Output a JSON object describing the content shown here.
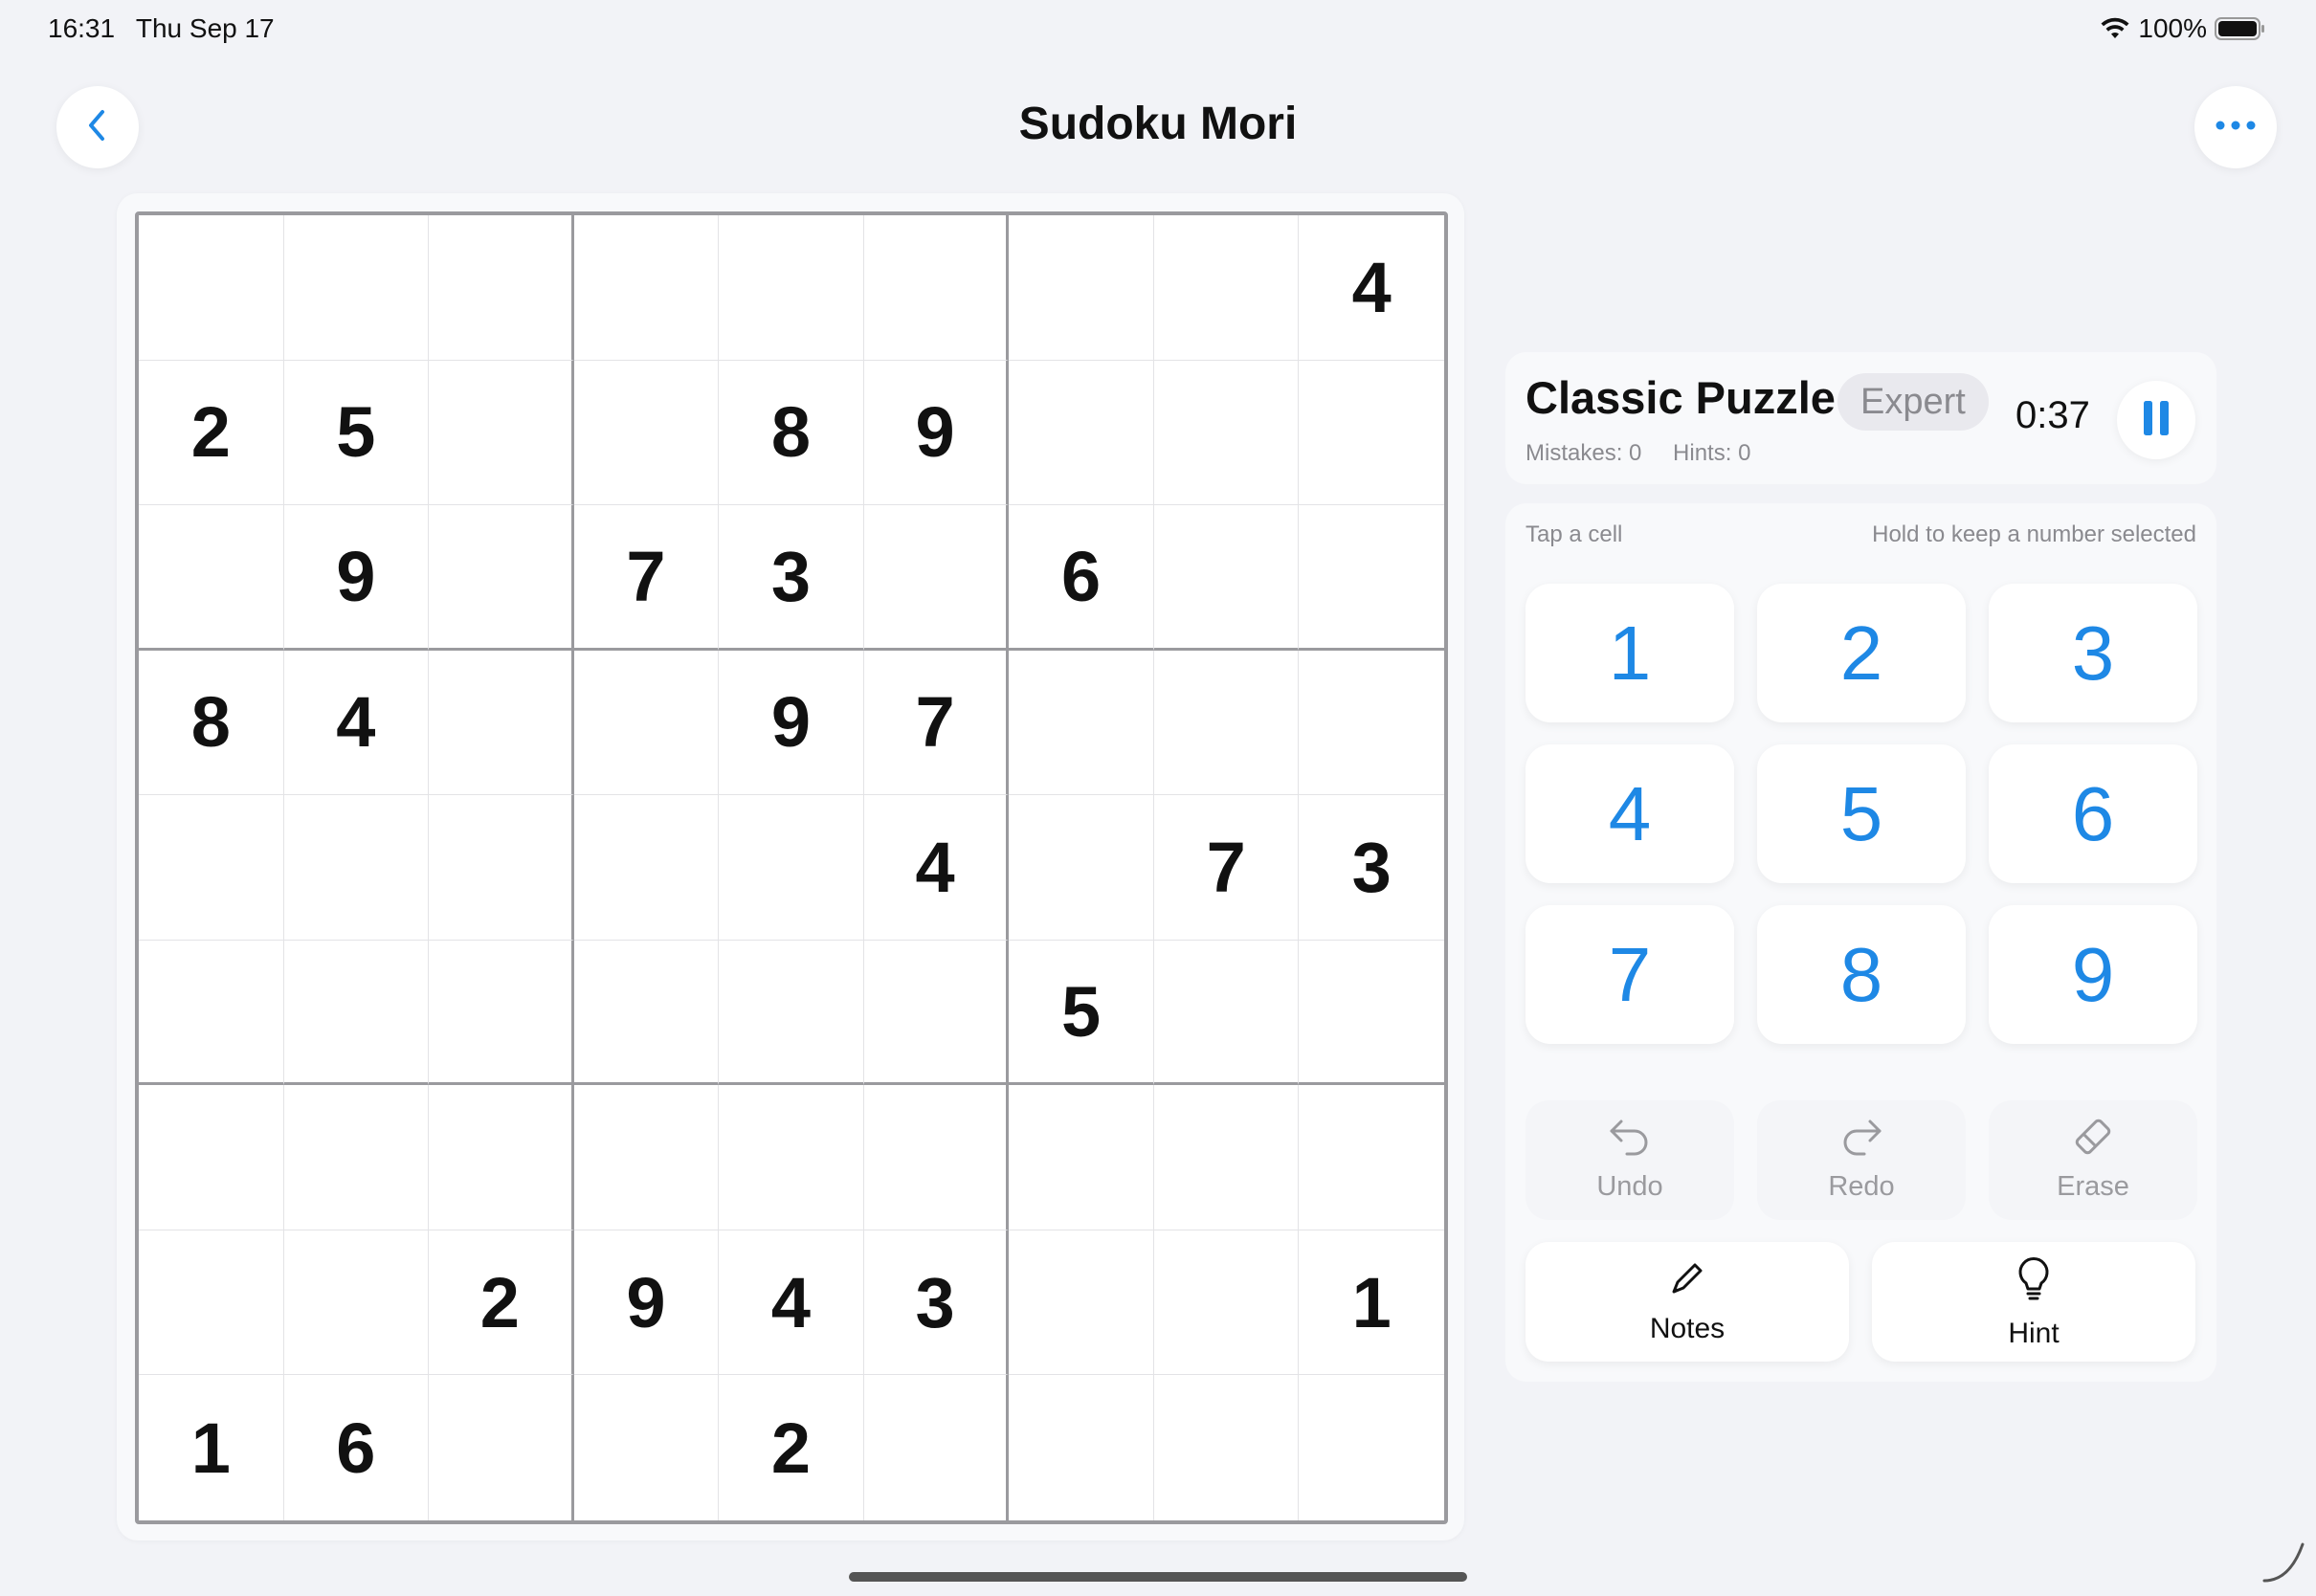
{
  "status": {
    "time": "16:31",
    "date": "Thu Sep 17",
    "battery": "100%"
  },
  "header": {
    "title": "Sudoku Mori",
    "back_icon": "chevron-left-icon",
    "more_icon": "ellipsis-icon"
  },
  "board": {
    "rows": [
      [
        "",
        "",
        "",
        "",
        "",
        "",
        "",
        "",
        "4"
      ],
      [
        "2",
        "5",
        "",
        "",
        "8",
        "9",
        "",
        "",
        ""
      ],
      [
        "",
        "9",
        "",
        "7",
        "3",
        "",
        "6",
        "",
        ""
      ],
      [
        "8",
        "4",
        "",
        "",
        "9",
        "7",
        "",
        "",
        ""
      ],
      [
        "",
        "",
        "",
        "",
        "",
        "4",
        "",
        "7",
        "3"
      ],
      [
        "",
        "",
        "",
        "",
        "",
        "",
        "5",
        "",
        ""
      ],
      [
        "",
        "",
        "",
        "",
        "",
        "",
        "",
        "",
        ""
      ],
      [
        "",
        "",
        "2",
        "9",
        "4",
        "3",
        "",
        "",
        "1"
      ],
      [
        "1",
        "6",
        "",
        "",
        "2",
        "",
        "",
        "",
        ""
      ]
    ]
  },
  "info": {
    "title": "Classic Puzzle",
    "difficulty": "Expert",
    "mistakes": "Mistakes: 0",
    "hints": "Hints: 0",
    "timer": "0:37"
  },
  "pad": {
    "hint_left": "Tap a cell",
    "hint_right": "Hold to keep a number selected",
    "numbers": [
      "1",
      "2",
      "3",
      "4",
      "5",
      "6",
      "7",
      "8",
      "9"
    ],
    "undo": "Undo",
    "redo": "Redo",
    "erase": "Erase",
    "notes": "Notes",
    "hint": "Hint"
  },
  "colors": {
    "accent": "#1e88e5",
    "background": "#f2f3f7",
    "grid_line": "#9a9a9e"
  }
}
